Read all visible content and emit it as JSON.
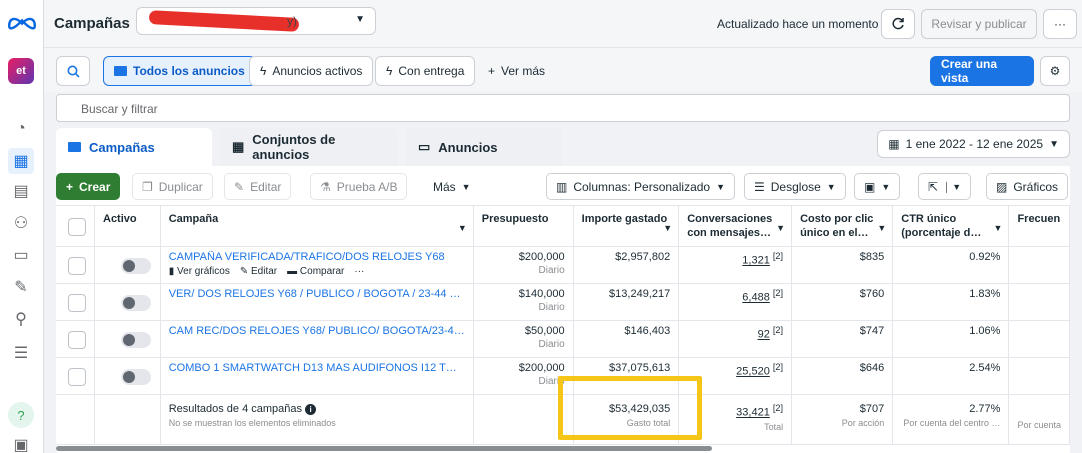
{
  "header": {
    "title": "Campañas",
    "account_suffix": "y)",
    "updated": "Actualizado hace un momento",
    "review_publish": "Revisar y publicar",
    "more": "···"
  },
  "filters": {
    "all_ads": "Todos los anuncios",
    "active_ads": "Anuncios activos",
    "with_delivery": "Con entrega",
    "see_more": "Ver más",
    "create_view": "Crear una vista",
    "search_placeholder": "Buscar y filtrar"
  },
  "tabs": {
    "campaigns": "Campañas",
    "adsets": "Conjuntos de anuncios",
    "ads": "Anuncios",
    "date_range": "1 ene 2022 - 12 ene 2025"
  },
  "toolbar": {
    "create": "Crear",
    "duplicate": "Duplicar",
    "edit": "Editar",
    "ab_test": "Prueba A/B",
    "more": "Más",
    "columns": "Columnas: Personalizado",
    "breakdown": "Desglose",
    "charts": "Gráficos"
  },
  "table": {
    "headers": {
      "active": "Activo",
      "campaign": "Campaña",
      "budget": "Presupuesto",
      "spent": "Importe gastado",
      "conversations": "Conversaciones con mensajes…",
      "cpc": "Costo por clic único en el…",
      "ctr": "CTR único (porcentaje d…",
      "frequency": "Frecuen"
    },
    "row_actions": {
      "charts": "Ver gráficos",
      "edit": "Editar",
      "compare": "Comparar",
      "more": "···"
    },
    "rows": [
      {
        "name": "CAMPAÑA VERIFICADA/TRAFICO/DOS RELOJES Y68",
        "budget": "$200,000",
        "budget_type": "Diario",
        "spent": "$2,957,802",
        "conversations": "1,321",
        "cpc": "$835",
        "ctr": "0.92%"
      },
      {
        "name": "VER/ DOS RELOJES Y68 / PUBLICO / BOGOTA / 23-44 …",
        "budget": "$140,000",
        "budget_type": "Diario",
        "spent": "$13,249,217",
        "conversations": "6,488",
        "cpc": "$760",
        "ctr": "1.83%"
      },
      {
        "name": "CAM REC/DOS RELOJES Y68/ PUBLICO/ BOGOTA/23-4…",
        "budget": "$50,000",
        "budget_type": "Diario",
        "spent": "$146,403",
        "conversations": "92",
        "cpc": "$747",
        "ctr": "1.06%"
      },
      {
        "name": "COMBO 1 SMARTWATCH D13 MAS AUDIFONOS I12 T…",
        "budget": "$200,000",
        "budget_type": "Diario",
        "spent": "$37,075,613",
        "conversations": "25,520",
        "cpc": "$646",
        "ctr": "2.54%"
      }
    ],
    "conv_marker": "[2]",
    "footer": {
      "label": "Resultados de 4 campañas",
      "sub": "No se muestran los elementos eliminados",
      "spent": "$53,429,035",
      "spent_sub": "Gasto total",
      "conversations": "33,421",
      "conversations_marker": "[2]",
      "conversations_sub": "Total",
      "cpc": "$707",
      "cpc_sub": "Por acción",
      "ctr": "2.77%",
      "ctr_sub": "Por cuenta del centro …",
      "freq_sub": "Por cuenta"
    }
  },
  "colors": {
    "brand": "#1b74e4",
    "create_green": "#2e7d32",
    "highlight": "#f5c518",
    "redaction": "#e8302b"
  }
}
